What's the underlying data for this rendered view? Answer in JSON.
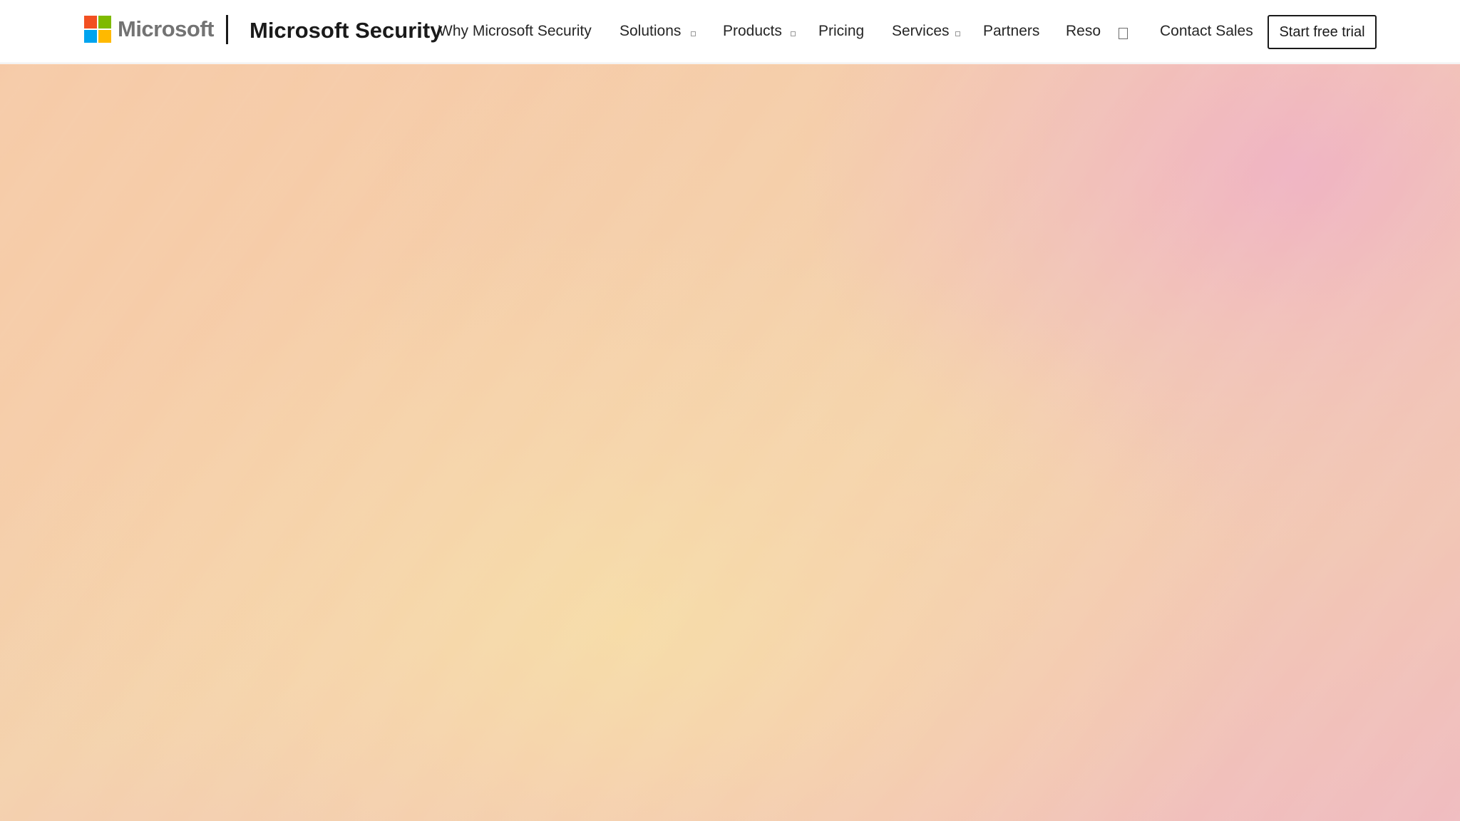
{
  "brand": {
    "company": "Microsoft",
    "product": "Microsoft Security",
    "logo_colors": [
      "#f25022",
      "#7fba00",
      "#00a4ef",
      "#ffb900"
    ]
  },
  "nav": {
    "items": [
      {
        "label": "Why Microsoft Security",
        "has_dropdown": false
      },
      {
        "label": "Solutions",
        "has_dropdown": true
      },
      {
        "label": "Products",
        "has_dropdown": true
      },
      {
        "label": "Pricing",
        "has_dropdown": false
      },
      {
        "label": "Services",
        "has_dropdown": true
      },
      {
        "label": "Partners",
        "has_dropdown": false
      },
      {
        "label": "Reso",
        "has_dropdown": false
      }
    ],
    "more_icon": "overflow-box-icon",
    "contact": "Contact Sales",
    "cta": "Start free trial"
  },
  "hero": {
    "colors": [
      "#f6c9a8",
      "#f7dda8",
      "#f0b2c4"
    ]
  }
}
